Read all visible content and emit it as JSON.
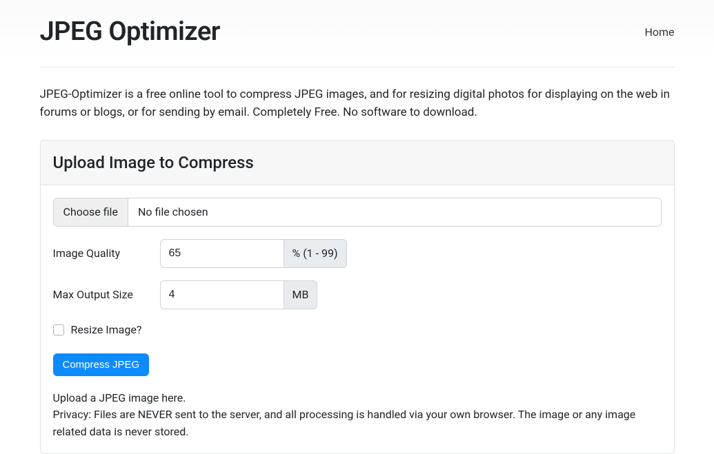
{
  "header": {
    "brand": "JPEG Optimizer",
    "nav": {
      "home": "Home"
    }
  },
  "intro": "JPEG-Optimizer is a free online tool to compress JPEG images, and for resizing digital photos for displaying on the web in forums or blogs, or for sending by email. Completely Free. No software to download.",
  "card": {
    "title": "Upload Image to Compress",
    "file": {
      "button": "Choose file",
      "status": "No file chosen"
    },
    "quality": {
      "label": "Image Quality",
      "value": "65",
      "addon": "% (1 - 99)"
    },
    "maxsize": {
      "label": "Max Output Size",
      "value": "4",
      "addon": "MB"
    },
    "resize": {
      "label": "Resize Image?"
    },
    "submit": "Compress JPEG",
    "help1": "Upload a JPEG image here.",
    "help2": "Privacy: Files are NEVER sent to the server, and all processing is handled via your own browser. The image or any image related data is never stored."
  }
}
